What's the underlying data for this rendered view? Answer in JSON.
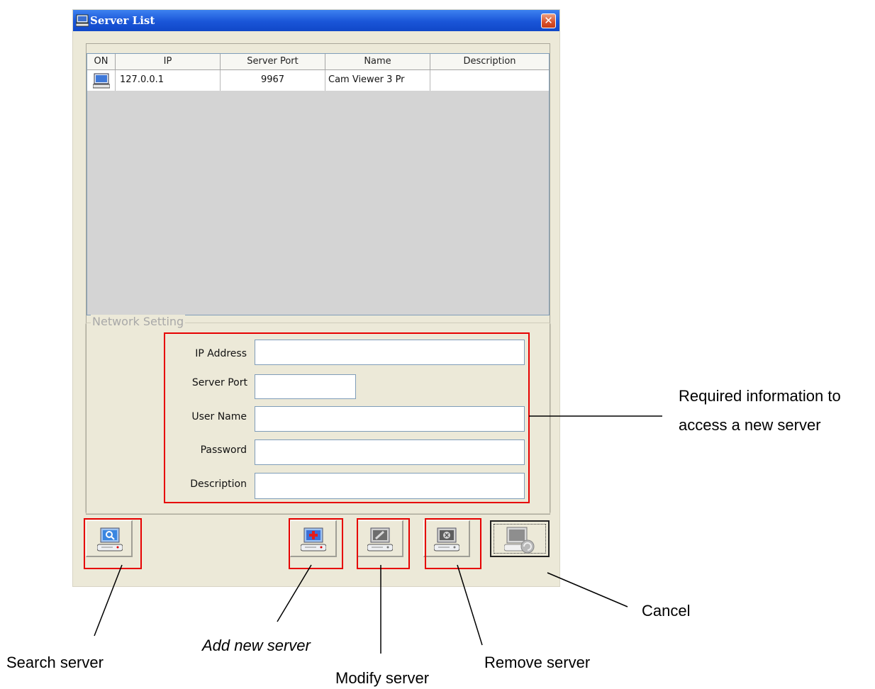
{
  "window": {
    "title": "Server List",
    "close_label": "✕"
  },
  "table": {
    "columns": [
      "ON",
      "IP",
      "Server Port",
      "Name",
      "Description"
    ],
    "rows": [
      {
        "ip": "127.0.0.1",
        "port": "9967",
        "name": "Cam Viewer 3 Pr",
        "description": ""
      }
    ]
  },
  "network": {
    "legend": "Network Setting",
    "fields": {
      "ip_address": {
        "label": "IP Address",
        "value": ""
      },
      "server_port": {
        "label": "Server Port",
        "value": ""
      },
      "user_name": {
        "label": "User Name",
        "value": ""
      },
      "password": {
        "label": "Password",
        "value": ""
      },
      "description": {
        "label": "Description",
        "value": ""
      }
    }
  },
  "buttons": {
    "search": "magnifier-server-icon",
    "add": "add-server-icon",
    "modify": "modify-server-icon",
    "remove": "remove-server-icon",
    "cancel": "cancel-server-icon"
  },
  "annotations": {
    "required_line1": "Required information to",
    "required_line2": "access a new server",
    "search": "Search server",
    "add": "Add new server",
    "modify": "Modify server",
    "remove": "Remove server",
    "cancel": "Cancel"
  },
  "colors": {
    "highlight": "#e60000",
    "titlebar": "#1a55d8",
    "dialog": "#ece9d8"
  }
}
